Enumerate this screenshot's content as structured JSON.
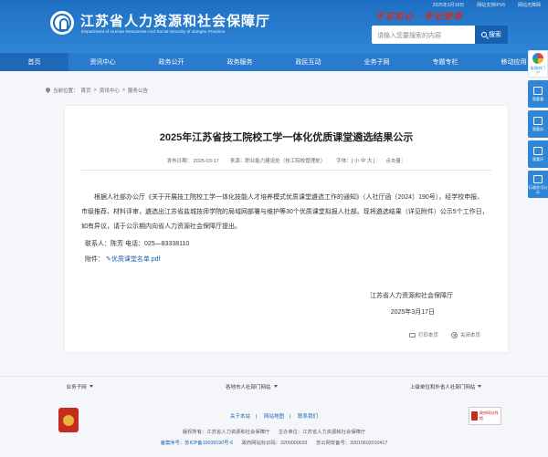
{
  "header": {
    "topbar": [
      "2025年3月18日",
      "网站支持IPV6",
      "网站无障碍"
    ],
    "site_name": "江苏省人力资源和社会保障厅",
    "site_en": "Department of Human Resources And Social Security of Jiangsu Province",
    "slogan": "不忘初心 · 牢记使命",
    "search_placeholder": "请输入您要搜索的内容",
    "search_button": "搜索"
  },
  "nav": [
    {
      "label": "首页"
    },
    {
      "label": "资讯中心"
    },
    {
      "label": "政务公开"
    },
    {
      "label": "政务服务"
    },
    {
      "label": "政民互动"
    },
    {
      "label": "业务子网"
    },
    {
      "label": "专题专栏"
    },
    {
      "label": "移动应用"
    }
  ],
  "breadcrumb": {
    "prefix": "当前位置：",
    "items": [
      "首页",
      "资讯中心",
      "服务公告"
    ]
  },
  "article": {
    "title": "2025年江苏省技工院校工学一体化优质课堂遴选结果公示",
    "publish_date": "发布日期： 2025-03-17",
    "source": "来源：职业能力建设处（技工院校管理处）",
    "font_size": "字体：[ 小 中 大 ]",
    "views": "点击量：",
    "body": "根据人社部办公厅《关于开展技工院校工学一体化技能人才培养模式优质课堂遴选工作的通知》（人社厅函〔2024〕190号），经学校申报、市级推荐、材料评审，遴选出江苏省盐城技师学院的局域网部署与维护等30个优质课堂拟报人社部。现将遴选结果（详见附件）公示5个工作日，如有异议，请于公示期内向省人力资源社会保障厅提出。",
    "contact": "联系人：陈芳  电话：025—83338110",
    "attachment_label": "附件：",
    "attachment_file": "优质课堂名单.pdf",
    "sign_org": "江苏省人力资源和社会保障厅",
    "sign_date": "2025年3月17日",
    "print_label": "打印本页",
    "close_label": "关闭本页"
  },
  "side": [
    {
      "label": "省政府门户"
    },
    {
      "label": "我要看"
    },
    {
      "label": "我要办"
    },
    {
      "label": "我要问"
    },
    {
      "label": "行政许可公示"
    }
  ],
  "footer_links": [
    "业务子网",
    "各地市人社部门网站",
    "上级单位和外省人社部门网站"
  ],
  "footer": {
    "links": [
      "关于本站",
      "网站地图",
      "联系我们"
    ],
    "line1": [
      "版权所有：江苏省人力资源和社会保障厅",
      "主办单位：江苏省人力资源和社会保障厅"
    ],
    "line2": [
      "备案序号：苏ICP备10039190号-6",
      "政府网站标识码：3200000033",
      "苏公网安备号：32010602010417"
    ],
    "badge": "政府网站找错"
  },
  "colors": {
    "brand_blue": "#2a7bcd",
    "dark_blue": "#1761b0",
    "slogan_red": "#d62a1f"
  }
}
